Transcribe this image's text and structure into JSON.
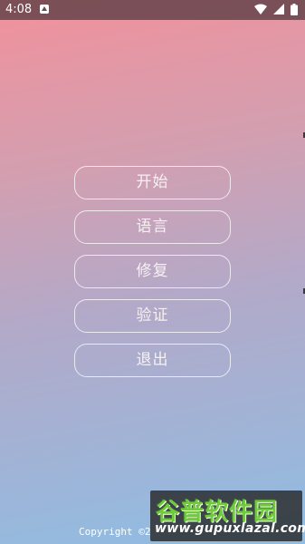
{
  "status_bar": {
    "time": "4:08"
  },
  "menu": {
    "items": [
      {
        "label": "开始"
      },
      {
        "label": "语言"
      },
      {
        "label": "修复"
      },
      {
        "label": "验证"
      },
      {
        "label": "退出"
      }
    ]
  },
  "footer": {
    "copyright": "Copyright ©2"
  },
  "watermark": {
    "title": "谷普软件园",
    "url": "www.gupuxlazal.com"
  },
  "colors": {
    "gradient_top": "#f1919b",
    "gradient_bottom": "#8fbde3",
    "button_border": "#ffffff",
    "watermark_green": "#72c83e"
  }
}
